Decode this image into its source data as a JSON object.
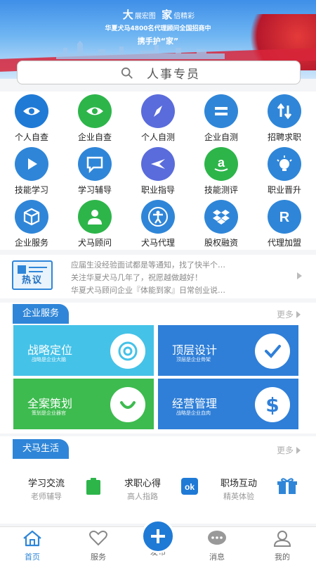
{
  "banner": {
    "big1": "大",
    "small1": "展宏图",
    "big2": "家",
    "small2": "倍精彩",
    "line2": "华夏犬马4800名代理顾问全国招商中",
    "line3": "携手护“家”"
  },
  "search": {
    "placeholder": "人事专员"
  },
  "grid": {
    "items": [
      {
        "label": "个人自查",
        "icon": "eye-icon",
        "color": "#1f7ad6"
      },
      {
        "label": "企业自查",
        "icon": "eye-icon",
        "color": "#2db54a"
      },
      {
        "label": "个人自测",
        "icon": "compass-icon",
        "color": "#5a6cdb"
      },
      {
        "label": "企业自测",
        "icon": "equals-icon",
        "color": "#2f86d8"
      },
      {
        "label": "招聘求职",
        "icon": "swap-arrows-icon",
        "color": "#2f86d8"
      },
      {
        "label": "技能学习",
        "icon": "play-icon",
        "color": "#2f86d8"
      },
      {
        "label": "学习辅导",
        "icon": "chat-icon",
        "color": "#2f86d8"
      },
      {
        "label": "职业指导",
        "icon": "lightning-icon",
        "color": "#5a6cdb"
      },
      {
        "label": "技能测评",
        "icon": "amazon-icon",
        "color": "#2db54a"
      },
      {
        "label": "职业晋升",
        "icon": "idea-icon",
        "color": "#2f86d8"
      },
      {
        "label": "企业服务",
        "icon": "cube-icon",
        "color": "#2f86d8"
      },
      {
        "label": "犬马顾问",
        "icon": "person-icon",
        "color": "#2db54a"
      },
      {
        "label": "犬马代理",
        "icon": "accessibility-icon",
        "color": "#2f86d8"
      },
      {
        "label": "股权融资",
        "icon": "dropbox-icon",
        "color": "#2f86d8"
      },
      {
        "label": "代理加盟",
        "icon": "letter-r-icon",
        "color": "#2f86d8"
      }
    ]
  },
  "news": {
    "badge": "热议",
    "lines": [
      "应届生没经验面试都是等通知，找了快半个…",
      "关注华夏犬马几年了，祝愿越做越好！",
      "华夏犬马顾问企业『体能到家』日常创业说…"
    ]
  },
  "enterprise": {
    "tag": "企业服务",
    "more": "更多",
    "cards": [
      {
        "title": "战略定位",
        "sub": "战略是企业大脑",
        "color": "#45c2e8",
        "icon": "target-icon"
      },
      {
        "title": "顶层设计",
        "sub": "顶层是企业骨架",
        "color": "#2f7fd8",
        "icon": "check-icon"
      },
      {
        "title": "全案策划",
        "sub": "策划是企业器官",
        "color": "#3dbb4f",
        "icon": "smile-icon"
      },
      {
        "title": "经营管理",
        "sub": "战略是企业血肉",
        "color": "#2f7fd8",
        "icon": "dollar-icon"
      }
    ]
  },
  "life": {
    "tag": "犬马生活",
    "more": "更多",
    "items": [
      {
        "title": "学习交流",
        "sub": "老师辅导"
      },
      {
        "title": "求职心得",
        "sub": "高人指路"
      },
      {
        "title": "职场互动",
        "sub": "精英体验"
      }
    ]
  },
  "tabbar": {
    "home": "首页",
    "service": "服务",
    "publish": "发布",
    "message": "消息",
    "mine": "我的",
    "active_color": "#2f86d8"
  }
}
